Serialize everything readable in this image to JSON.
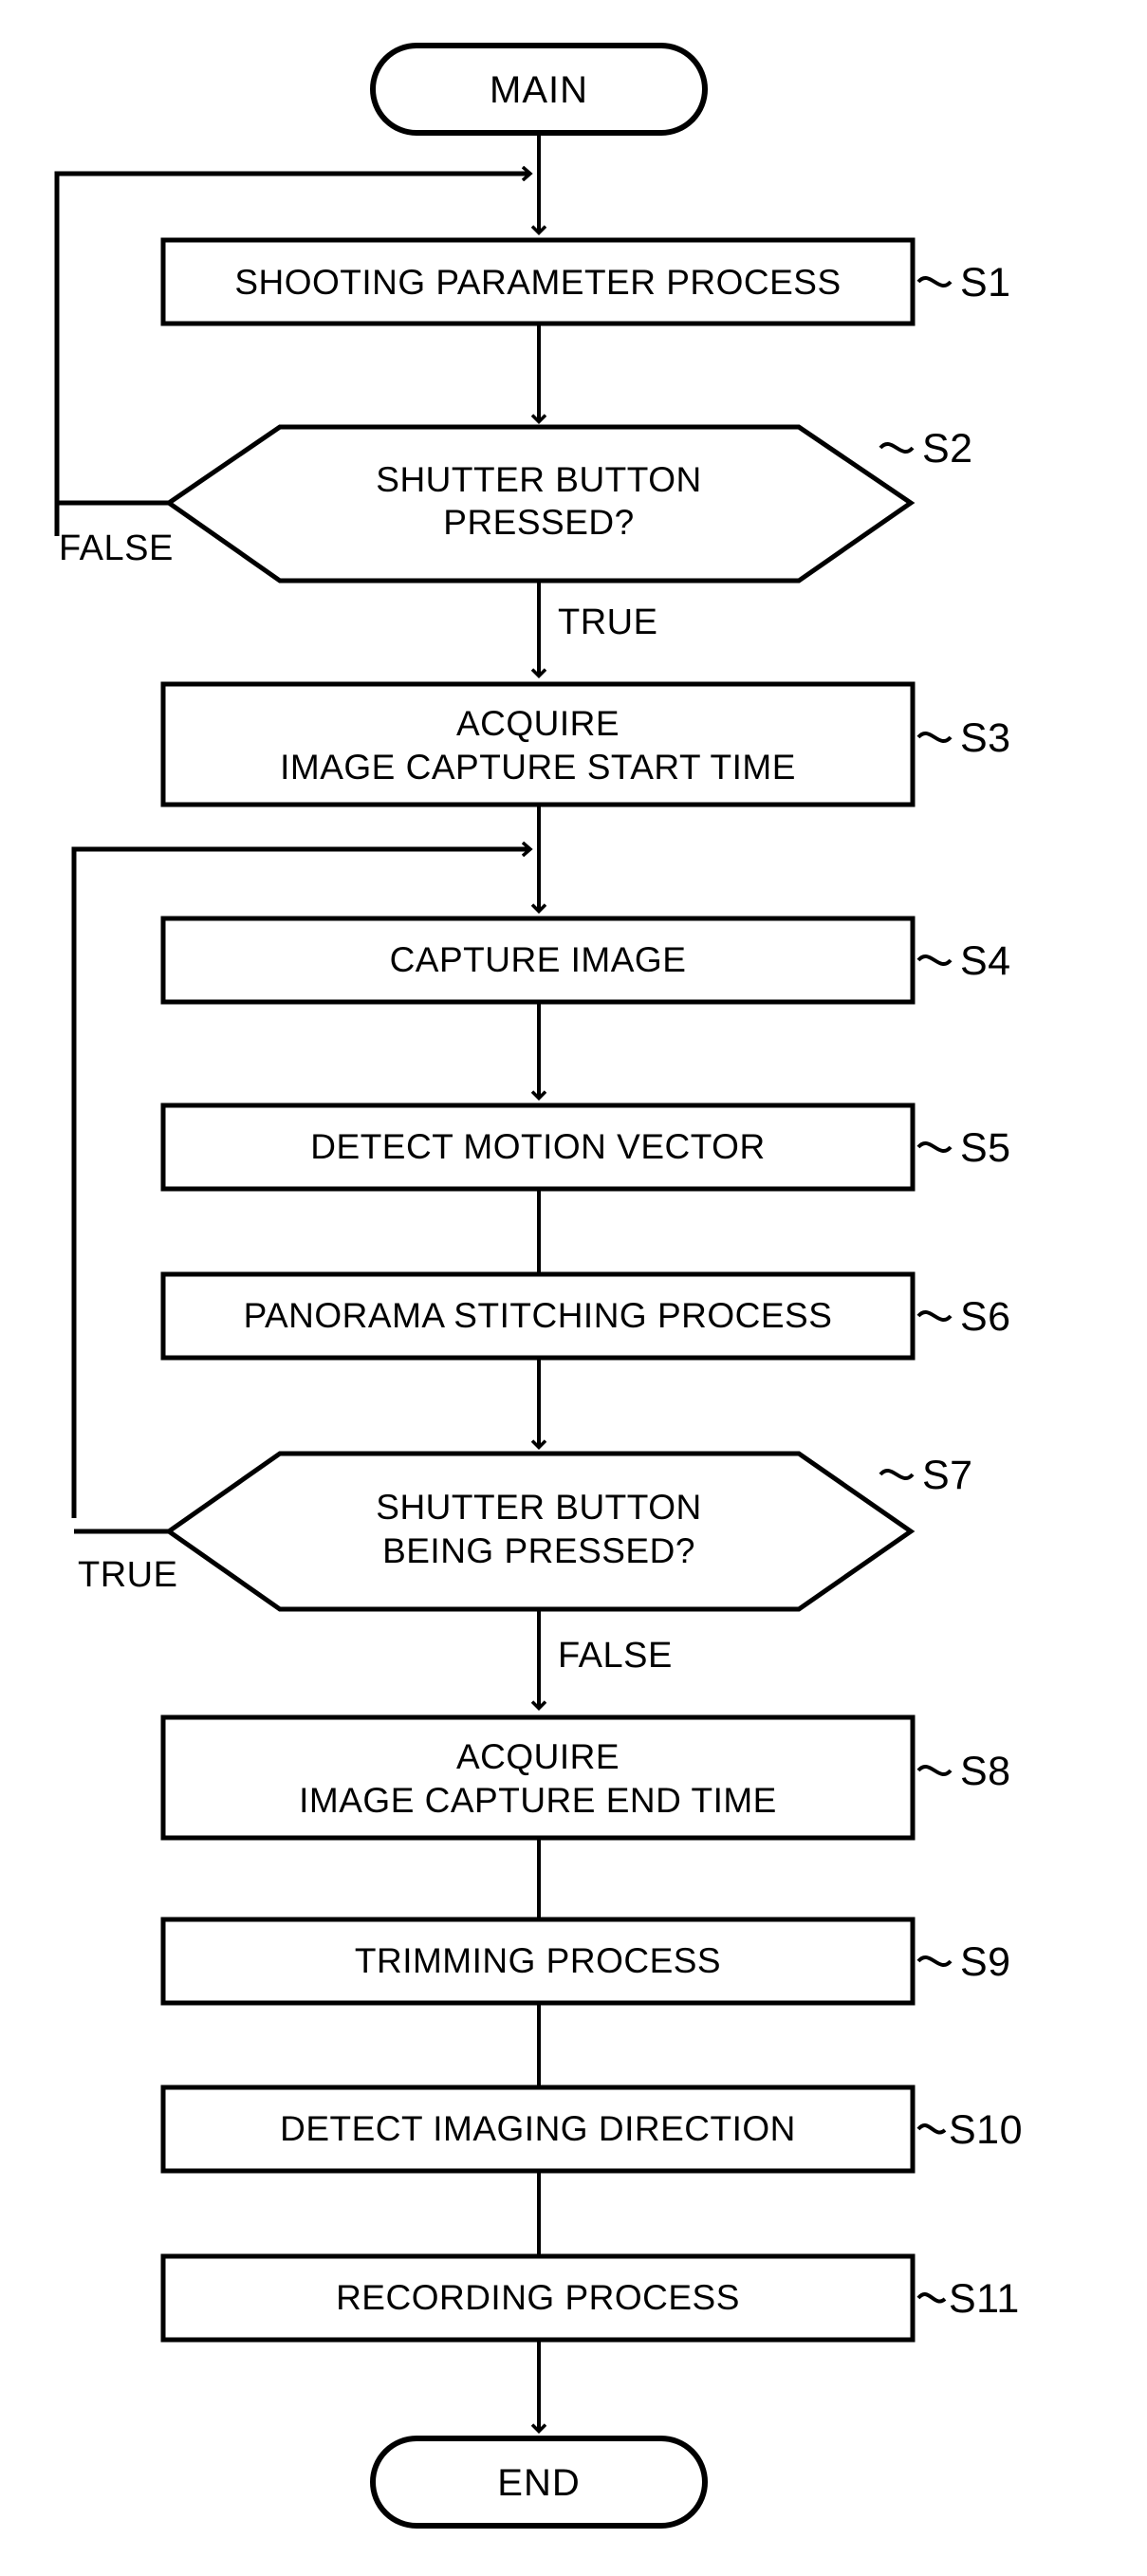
{
  "diagram": {
    "type": "flowchart",
    "title": "MAIN",
    "orientation": "top-to-bottom",
    "terminators": {
      "start": "MAIN",
      "end": "END"
    },
    "nodes": [
      {
        "id": "main",
        "shape": "terminator",
        "text": "MAIN",
        "step": ""
      },
      {
        "id": "s1",
        "shape": "process",
        "line1": "SHOOTING PARAMETER PROCESS",
        "line2": "",
        "step": "S1"
      },
      {
        "id": "s2",
        "shape": "decision",
        "line1": "SHUTTER BUTTON",
        "line2": "PRESSED?",
        "step": "S2"
      },
      {
        "id": "s3",
        "shape": "process",
        "line1": "ACQUIRE",
        "line2": "IMAGE CAPTURE START TIME",
        "step": "S3"
      },
      {
        "id": "s4",
        "shape": "process",
        "line1": "CAPTURE IMAGE",
        "line2": "",
        "step": "S4"
      },
      {
        "id": "s5",
        "shape": "process",
        "line1": "DETECT MOTION VECTOR",
        "line2": "",
        "step": "S5"
      },
      {
        "id": "s6",
        "shape": "process",
        "line1": "PANORAMA STITCHING PROCESS",
        "line2": "",
        "step": "S6"
      },
      {
        "id": "s7",
        "shape": "decision",
        "line1": "SHUTTER BUTTON",
        "line2": "BEING PRESSED?",
        "step": "S7"
      },
      {
        "id": "s8",
        "shape": "process",
        "line1": "ACQUIRE",
        "line2": "IMAGE CAPTURE END TIME",
        "step": "S8"
      },
      {
        "id": "s9",
        "shape": "process",
        "line1": "TRIMMING PROCESS",
        "line2": "",
        "step": "S9"
      },
      {
        "id": "s10",
        "shape": "process",
        "line1": "DETECT IMAGING DIRECTION",
        "line2": "",
        "step": "S10"
      },
      {
        "id": "s11",
        "shape": "process",
        "line1": "RECORDING PROCESS",
        "line2": "",
        "step": "S11"
      },
      {
        "id": "end",
        "shape": "terminator",
        "text": "END",
        "step": ""
      }
    ],
    "edge_labels": {
      "s2_false": "FALSE",
      "s2_true": "TRUE",
      "s7_true": "TRUE",
      "s7_false": "FALSE"
    },
    "colors": {
      "stroke": "#000000",
      "fill": "#ffffff",
      "background": "#ffffff"
    }
  }
}
